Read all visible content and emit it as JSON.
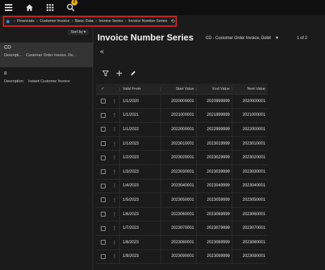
{
  "topbar": {
    "menu_icon": "hamburger-menu-icon",
    "home_icon": "home-icon",
    "apps_icon": "apps-grid-icon",
    "search_icon": "search-icon",
    "notification_count": "2"
  },
  "breadcrumb": {
    "items": [
      "Financials",
      "Customer Invoice",
      "Basic Data",
      "Invoice Series",
      "Invoice Number Series"
    ],
    "refresh_icon": "refresh-icon"
  },
  "leftpanel": {
    "sort_label": "Sort by",
    "items": [
      {
        "code": "CD",
        "desc_key": "Descripti...",
        "desc_value": "Customer Order Invoice, De..."
      },
      {
        "code": "II",
        "desc_key": "Description:",
        "desc_value": "Instant Customer Invoice"
      }
    ]
  },
  "main": {
    "title": "Invoice Number Series",
    "selector_value": "CD - Customer Order Invoice, Debit",
    "pager": "1 of 2",
    "collapse_icon": "double-chevron-left-icon"
  },
  "toolbar": {
    "filter_icon": "filter-icon",
    "add_icon": "add-icon",
    "edit_icon": "edit-icon"
  },
  "table": {
    "columns": [
      "Valid From",
      "Start Value",
      "End Value",
      "Next Value"
    ],
    "rows": [
      {
        "valid_from": "1/1/2020",
        "start": "2020000001",
        "end": "2020999999",
        "next": "2020000001"
      },
      {
        "valid_from": "1/1/2021",
        "start": "2021000001",
        "end": "2021999999",
        "next": "2021000001"
      },
      {
        "valid_from": "1/1/2022",
        "start": "2022000001",
        "end": "2022999999",
        "next": "2022000001"
      },
      {
        "valid_from": "1/1/2023",
        "start": "2023010001",
        "end": "2023019999",
        "next": "2023010001"
      },
      {
        "valid_from": "1/2/2023",
        "start": "2023020001",
        "end": "2023029999",
        "next": "2023020001"
      },
      {
        "valid_from": "1/3/2023",
        "start": "2023030001",
        "end": "2023039999",
        "next": "2023030001"
      },
      {
        "valid_from": "1/4/2023",
        "start": "2023040001",
        "end": "2023049999",
        "next": "2023040001"
      },
      {
        "valid_from": "1/5/2023",
        "start": "2023050001",
        "end": "2023059999",
        "next": "2023050001"
      },
      {
        "valid_from": "1/6/2023",
        "start": "2023060001",
        "end": "2023069999",
        "next": "2023060001"
      },
      {
        "valid_from": "1/7/2023",
        "start": "2023070001",
        "end": "2023079999",
        "next": "2023070001"
      },
      {
        "valid_from": "1/8/2023",
        "start": "2023080001",
        "end": "2023089999",
        "next": "2023080001"
      },
      {
        "valid_from": "1/9/2023",
        "start": "2023090001",
        "end": "2023099999",
        "next": "2023090001"
      }
    ]
  },
  "colors": {
    "highlight_border": "#d81d1d",
    "badge": "#f0b400",
    "background": "#1b1b1b"
  }
}
